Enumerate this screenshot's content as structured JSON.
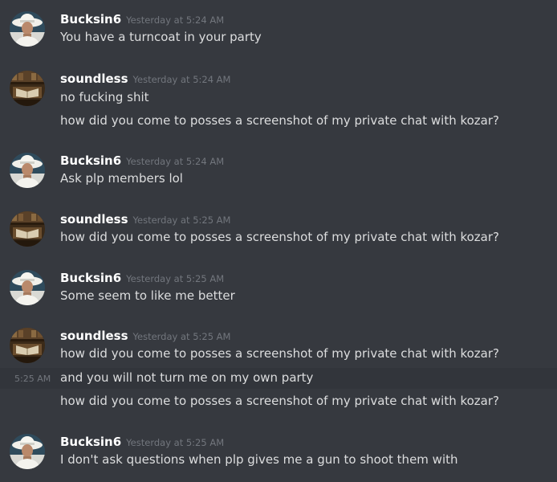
{
  "messages": [
    {
      "username": "Bucksin6",
      "timestamp": "Yesterday at 5:24 AM",
      "avatar": "cowboy-hat-avatar-icon",
      "lines": [
        "You have a turncoat in your party"
      ]
    },
    {
      "username": "soundless",
      "timestamp": "Yesterday at 5:24 AM",
      "avatar": "library-room-avatar-icon",
      "lines": [
        "no fucking shit",
        "how did you come to posses a screenshot of my private chat with kozar?"
      ]
    },
    {
      "username": "Bucksin6",
      "timestamp": "Yesterday at 5:24 AM",
      "avatar": "cowboy-hat-avatar-icon",
      "lines": [
        "Ask plp members lol"
      ]
    },
    {
      "username": "soundless",
      "timestamp": "Yesterday at 5:25 AM",
      "avatar": "library-room-avatar-icon",
      "lines": [
        "how did you come to posses a screenshot of my private chat with kozar?"
      ]
    },
    {
      "username": "Bucksin6",
      "timestamp": "Yesterday at 5:25 AM",
      "avatar": "cowboy-hat-avatar-icon",
      "lines": [
        "Some seem to like me better"
      ]
    },
    {
      "username": "soundless",
      "timestamp": "Yesterday at 5:25 AM",
      "avatar": "library-room-avatar-icon",
      "lines": [
        "how did you come to posses a screenshot of my private chat with kozar?",
        "and you will not turn me on my own party",
        "how did you come to posses a screenshot of my private chat with kozar?"
      ],
      "hovered_line_time": "5:25 AM"
    },
    {
      "username": "Bucksin6",
      "timestamp": "Yesterday at 5:25 AM",
      "avatar": "cowboy-hat-avatar-icon",
      "lines": [
        "I don't ask questions when plp gives me a gun to shoot them with"
      ]
    }
  ],
  "colors": {
    "background": "#36393f",
    "hover_background": "#32353b",
    "username": "#ffffff",
    "message_text": "#dcddde",
    "timestamp": "#72767d"
  }
}
